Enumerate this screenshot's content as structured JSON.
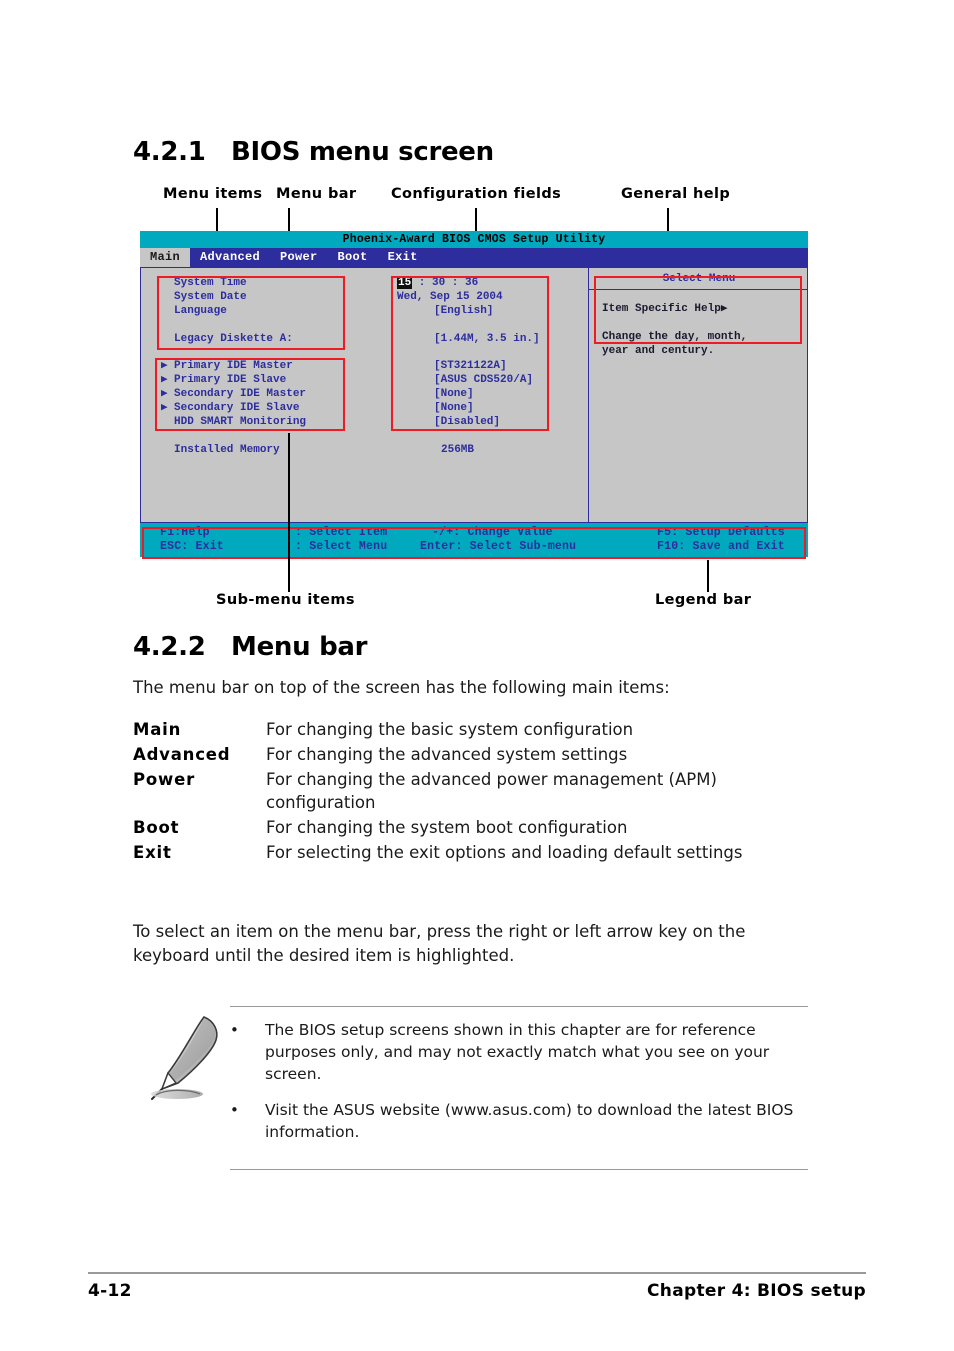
{
  "sections": {
    "s421": {
      "number": "4.2.1",
      "title": "BIOS menu screen"
    },
    "s422": {
      "number": "4.2.2",
      "title": "Menu bar"
    }
  },
  "callouts": {
    "menu_items": "Menu items",
    "menu_bar": "Menu bar",
    "configuration_fields": "Configuration fields",
    "general_help": "General help",
    "sub_menu_items": "Sub-menu items",
    "legend_bar": "Legend bar"
  },
  "bios": {
    "title": "Phoenix-Award BIOS CMOS Setup Utility",
    "menubar": [
      {
        "label": "Main",
        "active": true
      },
      {
        "label": "Advanced",
        "active": false
      },
      {
        "label": "Power",
        "active": false
      },
      {
        "label": "Boot",
        "active": false
      },
      {
        "label": "Exit",
        "active": false
      }
    ],
    "items": [
      {
        "label": "System Time",
        "value_prefix": "",
        "highlight": "15",
        "value": " :  30 :  36",
        "arrow": false
      },
      {
        "label": "System Date",
        "value": "Wed, Sep 15 2004",
        "arrow": false
      },
      {
        "label": "Language",
        "value": "[English]",
        "arrow": false
      },
      {
        "label": "Legacy Diskette A:",
        "value": "[1.44M, 3.5 in.]",
        "arrow": false
      },
      {
        "label": "Primary IDE Master",
        "value": "[ST321122A]",
        "arrow": true
      },
      {
        "label": "Primary IDE Slave",
        "value": "[ASUS CDS520/A]",
        "arrow": true
      },
      {
        "label": "Secondary IDE Master",
        "value": "[None]",
        "arrow": true
      },
      {
        "label": "Secondary IDE Slave",
        "value": "[None]",
        "arrow": true
      },
      {
        "label": "HDD SMART Monitoring",
        "value": "[Disabled]",
        "arrow": false
      },
      {
        "label": "Installed Memory",
        "value": "256MB",
        "arrow": false
      }
    ],
    "help": {
      "panel_title": "Select Menu",
      "heading": "Item Specific Help▶",
      "line1": "Change the day, month,",
      "line2": "year and century."
    },
    "legend": {
      "r1c1": "F1:Help",
      "r1c2": ":  Select Item",
      "r1c3": "-/+:  Change Value",
      "r1c4": "F5:  Setup Defaults",
      "r2c1": "ESC: Exit",
      "r2c2": ":  Select Menu",
      "r2c3": "Enter: Select Sub-menu",
      "r2c4": "F10: Save and Exit"
    }
  },
  "menu_bar_section": {
    "intro": "The menu bar on top of the screen has the following main items:",
    "definitions": [
      {
        "term": "Main",
        "desc": "For changing the basic system configuration"
      },
      {
        "term": "Advanced",
        "desc": "For changing the advanced system settings"
      },
      {
        "term": "Power",
        "desc": "For changing the advanced power management (APM) configuration"
      },
      {
        "term": "Boot",
        "desc": "For changing the system boot configuration"
      },
      {
        "term": "Exit",
        "desc": "For selecting the exit options and loading default settings"
      }
    ],
    "outro": "To select an item on the menu bar, press the right or left arrow key on the keyboard until the desired item is highlighted."
  },
  "note": {
    "bullet": "•",
    "items": [
      "The BIOS setup screens shown in this chapter are for reference purposes only, and may not exactly match what you see on your screen.",
      "Visit the ASUS website (www.asus.com) to download the latest BIOS information."
    ]
  },
  "footer": {
    "page": "4-12",
    "chapter": "Chapter 4: BIOS setup"
  },
  "colors": {
    "bios_title_bar": "#00a9bd",
    "bios_menu_bar": "#2d2d9e",
    "bios_body": "#c6c6c6",
    "bios_text": "#2d2d9e",
    "annotation_red": "#ed1c24"
  }
}
